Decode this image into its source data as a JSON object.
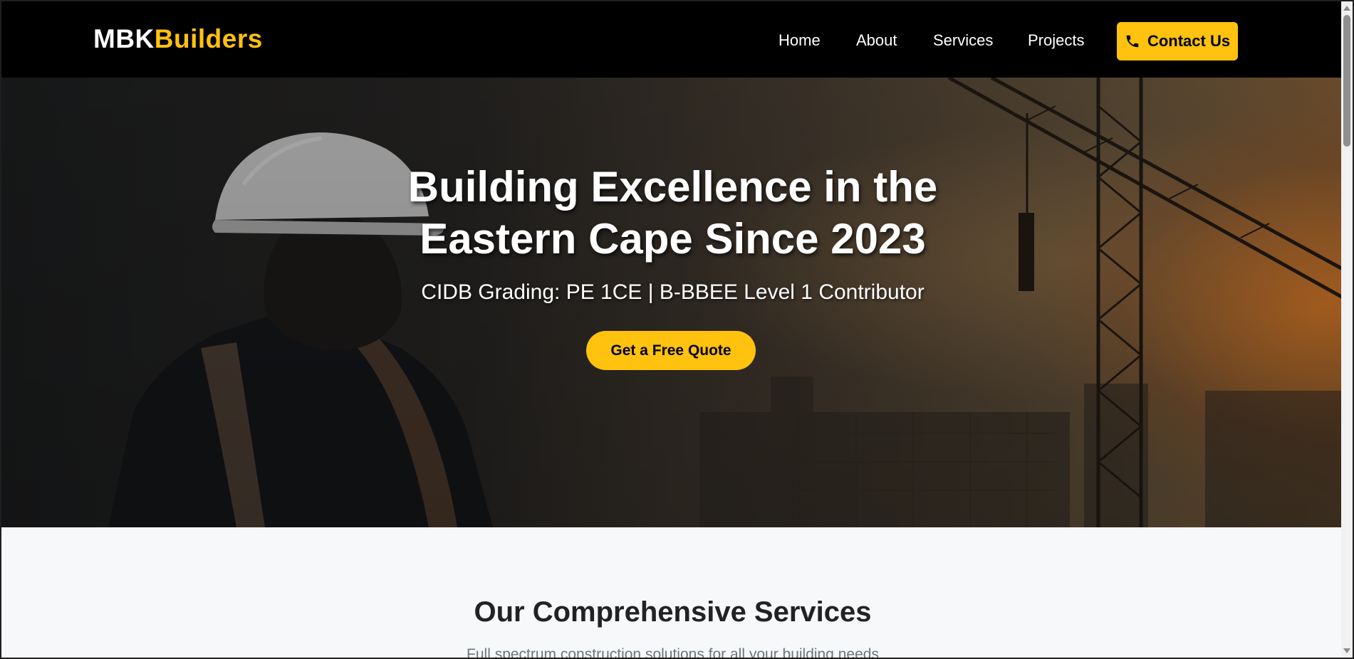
{
  "navbar": {
    "logo_part1": "MBK",
    "logo_part2": "Builders",
    "links": [
      {
        "label": "Home"
      },
      {
        "label": "About"
      },
      {
        "label": "Services"
      },
      {
        "label": "Projects"
      }
    ],
    "contact": {
      "label": "Contact Us",
      "icon": "phone-icon"
    }
  },
  "hero": {
    "title": "Building Excellence in the\nEastern Cape Since 2023",
    "subtitle": "CIDB Grading: PE 1CE | B-BBEE Level 1 Contributor",
    "cta_label": "Get a Free Quote"
  },
  "services": {
    "title": "Our Comprehensive Services",
    "subtitle": "Full spectrum construction solutions for all your building needs"
  },
  "colors": {
    "accent": "#ffc20e",
    "navbar_bg": "#000000",
    "section_bg": "#f7f8fa"
  }
}
